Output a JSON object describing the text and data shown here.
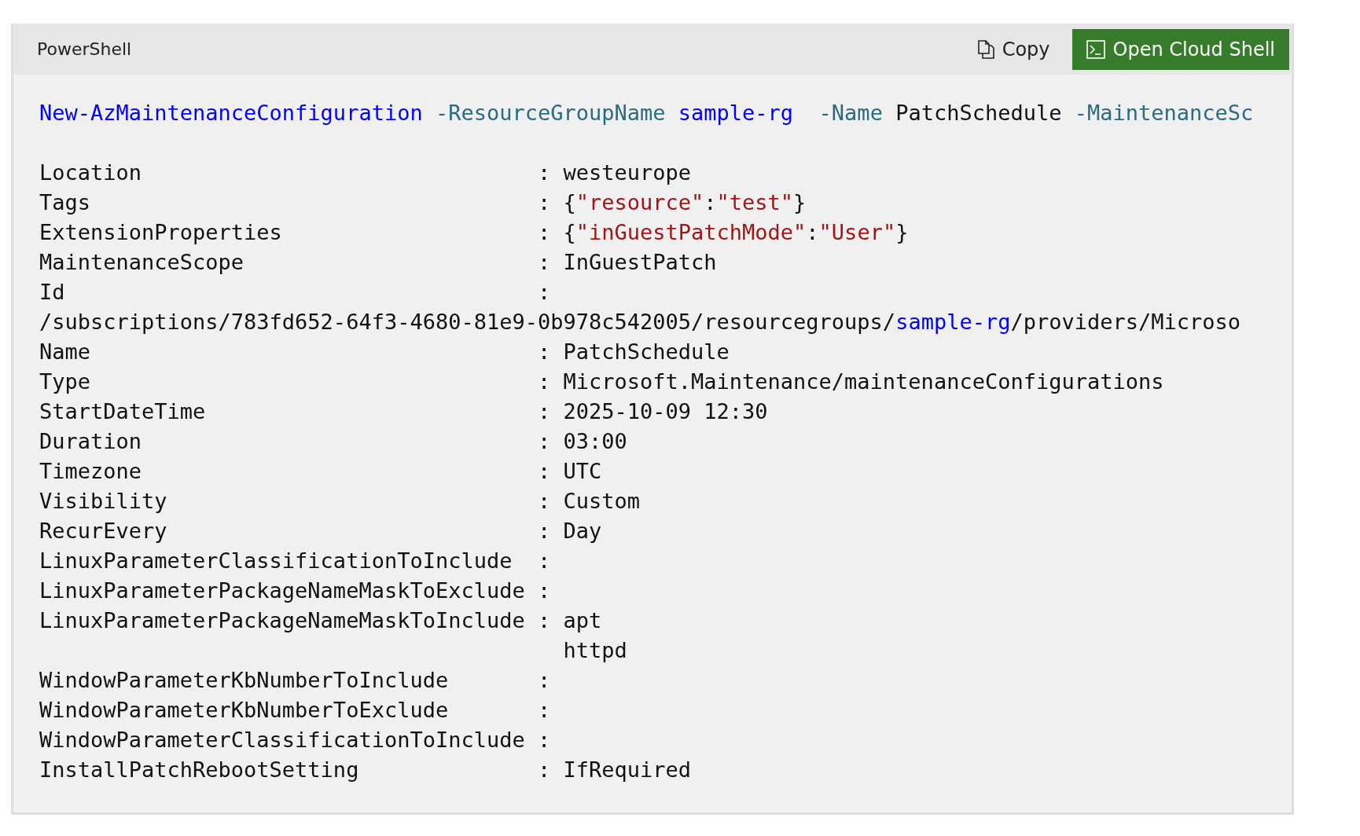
{
  "header": {
    "language": "PowerShell",
    "buttons": [
      {
        "kind": "copy",
        "label": "Copy"
      },
      {
        "kind": "cloud-shell",
        "label": "Open Cloud Shell"
      }
    ]
  },
  "command": [
    {
      "kind": "cmdlet",
      "text": "New-AzMaintenanceConfiguration"
    },
    {
      "kind": "param",
      "text": " -ResourceGroupName"
    },
    {
      "kind": "value",
      "text": " sample-rg"
    },
    {
      "kind": "param",
      "text": "  -Name"
    },
    {
      "kind": "plain",
      "text": " PatchSchedule"
    },
    {
      "kind": "param",
      "text": " -MaintenanceSc"
    }
  ],
  "output": [
    [
      {
        "kind": "plain",
        "text": "Location                               : westeurope"
      }
    ],
    [
      {
        "kind": "plain",
        "text": "Tags                                   : {"
      },
      {
        "kind": "string",
        "text": "\"resource\""
      },
      {
        "kind": "plain",
        "text": ":"
      },
      {
        "kind": "string",
        "text": "\"test\""
      },
      {
        "kind": "plain",
        "text": "}"
      }
    ],
    [
      {
        "kind": "plain",
        "text": "ExtensionProperties                    : {"
      },
      {
        "kind": "string",
        "text": "\"inGuestPatchMode\""
      },
      {
        "kind": "plain",
        "text": ":"
      },
      {
        "kind": "string",
        "text": "\"User\""
      },
      {
        "kind": "plain",
        "text": "}"
      }
    ],
    [
      {
        "kind": "plain",
        "text": "MaintenanceScope                       : InGuestPatch"
      }
    ],
    [
      {
        "kind": "plain",
        "text": "Id                                     :"
      }
    ],
    [
      {
        "kind": "plain",
        "text": "/subscriptions/783fd652-64f3-4680-81e9-0b978c542005/resourcegroups/"
      },
      {
        "kind": "value",
        "text": "sample-rg"
      },
      {
        "kind": "plain",
        "text": "/providers/Microso"
      }
    ],
    [
      {
        "kind": "plain",
        "text": "Name                                   : PatchSchedule"
      }
    ],
    [
      {
        "kind": "plain",
        "text": "Type                                   : Microsoft.Maintenance/maintenanceConfigurations"
      }
    ],
    [
      {
        "kind": "plain",
        "text": "StartDateTime                          : 2025-10-09 12:30"
      }
    ],
    [
      {
        "kind": "plain",
        "text": "Duration                               : 03:00"
      }
    ],
    [
      {
        "kind": "plain",
        "text": "Timezone                               : UTC"
      }
    ],
    [
      {
        "kind": "plain",
        "text": "Visibility                             : Custom"
      }
    ],
    [
      {
        "kind": "plain",
        "text": "RecurEvery                             : Day"
      }
    ],
    [
      {
        "kind": "plain",
        "text": "LinuxParameterClassificationToInclude  :"
      }
    ],
    [
      {
        "kind": "plain",
        "text": "LinuxParameterPackageNameMaskToExclude :"
      }
    ],
    [
      {
        "kind": "plain",
        "text": "LinuxParameterPackageNameMaskToInclude : apt"
      }
    ],
    [
      {
        "kind": "plain",
        "text": "                                         httpd"
      }
    ],
    [
      {
        "kind": "plain",
        "text": "WindowParameterKbNumberToInclude       :"
      }
    ],
    [
      {
        "kind": "plain",
        "text": "WindowParameterKbNumberToExclude       :"
      }
    ],
    [
      {
        "kind": "plain",
        "text": "WindowParameterClassificationToInclude :"
      }
    ],
    [
      {
        "kind": "plain",
        "text": "InstallPatchRebootSetting              : IfRequired"
      }
    ]
  ]
}
